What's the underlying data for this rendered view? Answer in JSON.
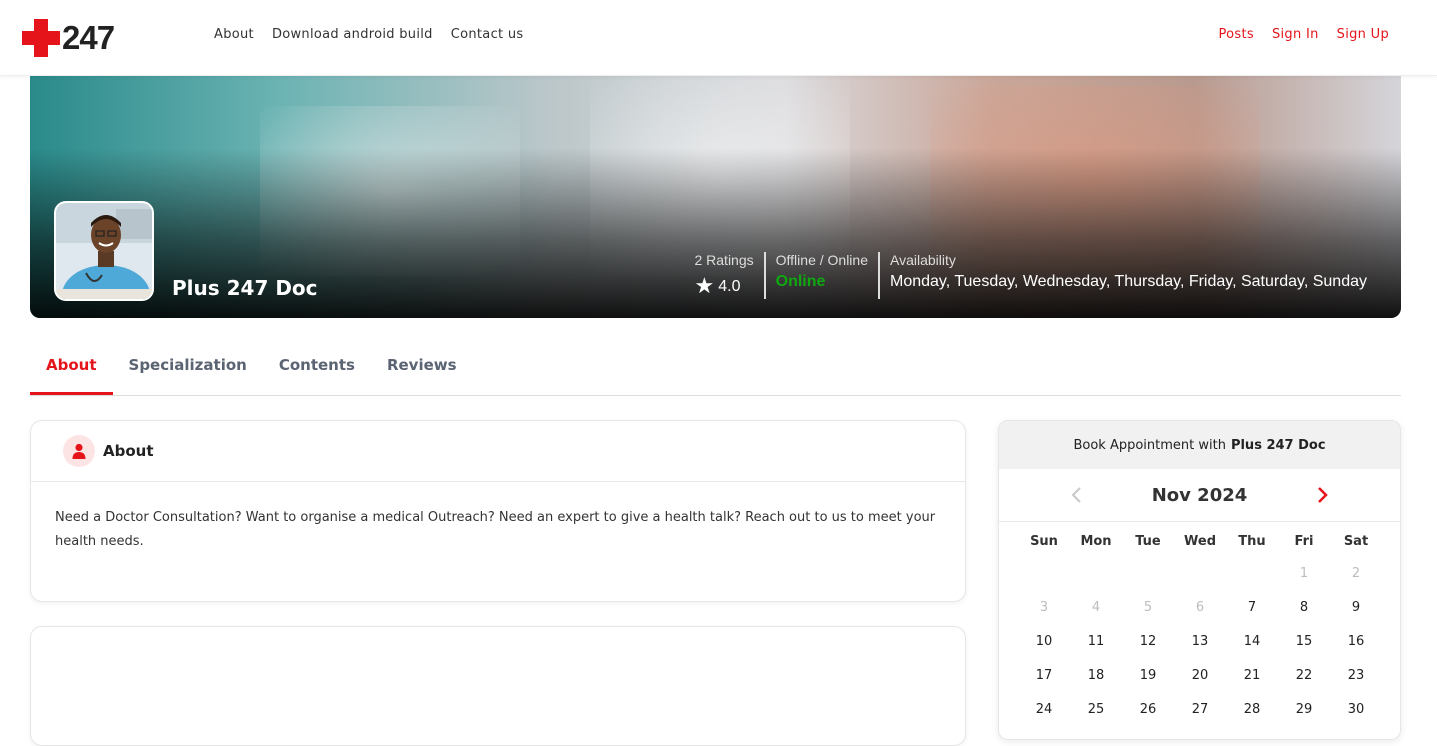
{
  "nav": {
    "logo_text": "247",
    "links": [
      "About",
      "Download android build",
      "Contact us"
    ],
    "right_links": [
      "Posts",
      "Sign In",
      "Sign Up"
    ],
    "brand_color": "#e5141b"
  },
  "profile": {
    "name": "Plus 247 Doc",
    "ratings_label": "2 Ratings",
    "rating_value": "4.0",
    "status_label": "Offline / Online",
    "status_value": "Online",
    "status_color": "#0fa80f",
    "availability_label": "Availability",
    "availability_value": "Monday, Tuesday, Wednesday, Thursday, Friday, Saturday, Sunday"
  },
  "tabs": [
    "About",
    "Specialization",
    "Contents",
    "Reviews"
  ],
  "active_tab": "About",
  "about": {
    "title": "About",
    "text": "Need a Doctor Consultation? Want to organise a medical Outreach? Need an expert to give a health talk? Reach out to us to meet your health needs."
  },
  "booking": {
    "title_prefix": "Book Appointment with",
    "doctor": "Plus 247 Doc",
    "month": "Nov 2024",
    "weekdays": [
      "Sun",
      "Mon",
      "Tue",
      "Wed",
      "Thu",
      "Fri",
      "Sat"
    ],
    "weeks": [
      [
        {
          "d": "",
          "muted": false
        },
        {
          "d": "",
          "muted": false
        },
        {
          "d": "",
          "muted": false
        },
        {
          "d": "",
          "muted": false
        },
        {
          "d": "",
          "muted": false
        },
        {
          "d": "1",
          "muted": true
        },
        {
          "d": "2",
          "muted": true
        }
      ],
      [
        {
          "d": "3",
          "muted": true
        },
        {
          "d": "4",
          "muted": true
        },
        {
          "d": "5",
          "muted": true
        },
        {
          "d": "6",
          "muted": true
        },
        {
          "d": "7",
          "muted": false
        },
        {
          "d": "8",
          "muted": false
        },
        {
          "d": "9",
          "muted": false
        }
      ],
      [
        {
          "d": "10",
          "muted": false
        },
        {
          "d": "11",
          "muted": false
        },
        {
          "d": "12",
          "muted": false
        },
        {
          "d": "13",
          "muted": false
        },
        {
          "d": "14",
          "muted": false
        },
        {
          "d": "15",
          "muted": false
        },
        {
          "d": "16",
          "muted": false
        }
      ],
      [
        {
          "d": "17",
          "muted": false
        },
        {
          "d": "18",
          "muted": false
        },
        {
          "d": "19",
          "muted": false
        },
        {
          "d": "20",
          "muted": false
        },
        {
          "d": "21",
          "muted": false
        },
        {
          "d": "22",
          "muted": false
        },
        {
          "d": "23",
          "muted": false
        }
      ],
      [
        {
          "d": "24",
          "muted": false
        },
        {
          "d": "25",
          "muted": false
        },
        {
          "d": "26",
          "muted": false
        },
        {
          "d": "27",
          "muted": false
        },
        {
          "d": "28",
          "muted": false
        },
        {
          "d": "29",
          "muted": false
        },
        {
          "d": "30",
          "muted": false
        }
      ]
    ]
  }
}
